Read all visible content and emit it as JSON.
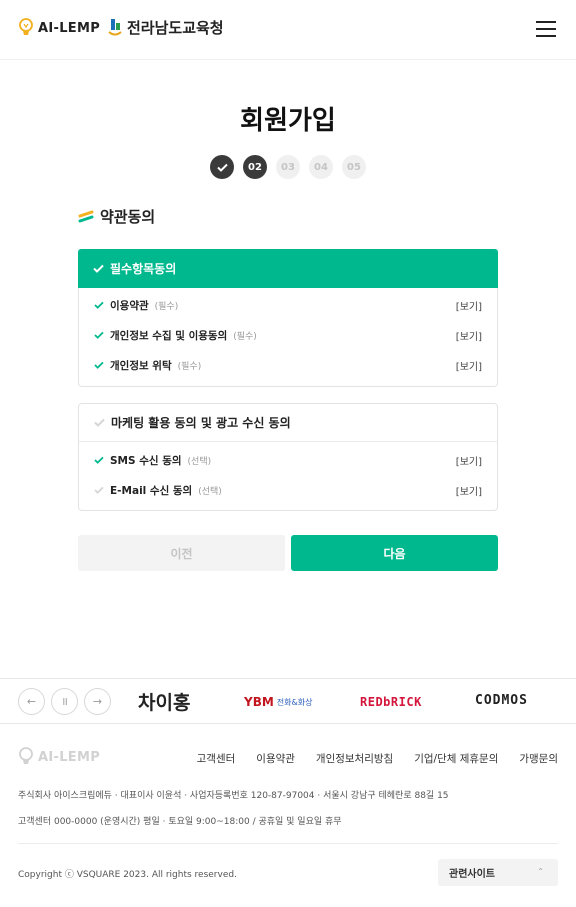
{
  "header": {
    "logo_ai": "AI-LEMP",
    "logo_org": "전라남도교육청",
    "menu_icon": "hamburger-icon"
  },
  "page": {
    "title": "회원가입",
    "steps": [
      "02",
      "03",
      "04",
      "05"
    ],
    "section_title": "약관동의"
  },
  "required_box": {
    "header": "필수항목동의",
    "items": [
      {
        "label": "이용약관",
        "tag": "(필수)",
        "view": "[보기]"
      },
      {
        "label": "개인정보 수집 및 이용동의",
        "tag": "(필수)",
        "view": "[보기]"
      },
      {
        "label": "개인정보 위탁",
        "tag": "(필수)",
        "view": "[보기]"
      }
    ]
  },
  "optional_box": {
    "header": "마케팅 활용 동의 및 광고 수신 동의",
    "items": [
      {
        "label": "SMS 수신 동의",
        "tag": "(선택)",
        "view": "[보기]"
      },
      {
        "label": "E-Mail 수신 동의",
        "tag": "(선택)",
        "view": "[보기]"
      }
    ]
  },
  "buttons": {
    "prev": "이전",
    "next": "다음"
  },
  "partners": {
    "p1": "차이홍",
    "p2_mark": "YBM",
    "p2_sub": "전화&화상",
    "p3": "REDbRICK",
    "p4": "CODMOS"
  },
  "footer": {
    "logo": "AI-LEMP",
    "links": [
      "고객센터",
      "이용약관",
      "개인정보처리방침",
      "기업/단체 제휴문의",
      "가맹문의"
    ],
    "info1": "주식회사 아이스크림에듀 · 대표이사 이윤석 · 사업자등록번호 120-87-97004 · 서울시 강남구 테헤란로 88길 15",
    "info2": "고객센터 000-0000 (운영시간) 평일 · 토요일 9:00~18:00 / 공휴일 및 일요일 휴무",
    "copyright": "Copyright ⓒ VSQUARE 2023. All rights reserved.",
    "related": "관련사이트"
  },
  "colors": {
    "accent": "#00b88d",
    "dark": "#3a3a3a"
  }
}
